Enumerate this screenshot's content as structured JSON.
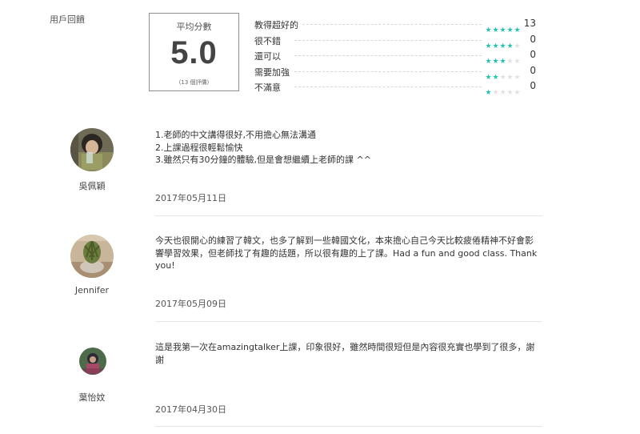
{
  "rating_section": {
    "label": "用戶回饋",
    "average_title": "平均分數",
    "average_score": "5.0",
    "review_count_text": "(13 個評價)",
    "breakdown": [
      {
        "label": "教得超好的",
        "stars": 5,
        "count": "13"
      },
      {
        "label": "很不錯",
        "stars": 4,
        "count": "0"
      },
      {
        "label": "還可以",
        "stars": 3,
        "count": "0"
      },
      {
        "label": "需要加強",
        "stars": 2,
        "count": "0"
      },
      {
        "label": "不滿意",
        "stars": 1,
        "count": "0"
      }
    ],
    "star_color": "#22c4b0"
  },
  "reviews": [
    {
      "name": "吳佩穎",
      "text": "1.老師的中文講得很好,不用擔心無法溝通\n2.上課過程很輕鬆愉快\n3.雖然只有30分鐘的體驗,但是會想繼續上老師的課 ^^",
      "date": "2017年05月11日"
    },
    {
      "name": "Jennifer",
      "text": "今天也很開心的練習了韓文，也多了解到一些韓國文化，本來擔心自己今天比較疲倦精神不好會影響學習效果，但老師找了有趣的話題，所以很有趣的上了課。Had a fun and good class. Thank you!",
      "date": "2017年05月09日"
    },
    {
      "name": "葉怡妏",
      "text": "這是我第一次在amazingtalker上課，印象很好，雖然時間很短但是內容很充實也學到了很多，謝謝",
      "date": "2017年04月30日"
    }
  ]
}
